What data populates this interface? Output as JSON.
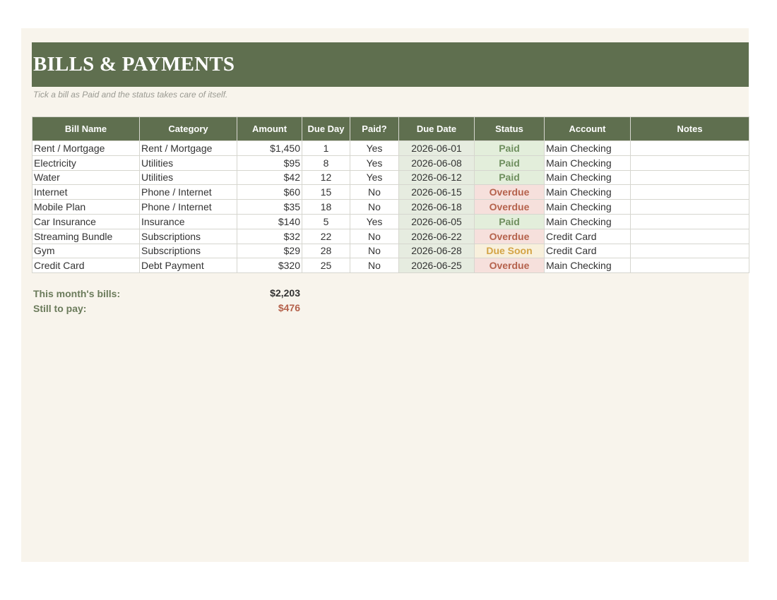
{
  "title": "BILLS & PAYMENTS",
  "subtitle": "Tick a bill as Paid and the status takes care of itself.",
  "columns": [
    "Bill Name",
    "Category",
    "Amount",
    "Due Day",
    "Paid?",
    "Due Date",
    "Status",
    "Account",
    "Notes"
  ],
  "rows": [
    {
      "name": "Rent / Mortgage",
      "category": "Rent / Mortgage",
      "amount": "$1,450",
      "due_day": "1",
      "paid": "Yes",
      "due_date": "2026-06-01",
      "status": "Paid",
      "status_kind": "paid",
      "account": "Main Checking",
      "notes": ""
    },
    {
      "name": "Electricity",
      "category": "Utilities",
      "amount": "$95",
      "due_day": "8",
      "paid": "Yes",
      "due_date": "2026-06-08",
      "status": "Paid",
      "status_kind": "paid",
      "account": "Main Checking",
      "notes": ""
    },
    {
      "name": "Water",
      "category": "Utilities",
      "amount": "$42",
      "due_day": "12",
      "paid": "Yes",
      "due_date": "2026-06-12",
      "status": "Paid",
      "status_kind": "paid",
      "account": "Main Checking",
      "notes": ""
    },
    {
      "name": "Internet",
      "category": "Phone / Internet",
      "amount": "$60",
      "due_day": "15",
      "paid": "No",
      "due_date": "2026-06-15",
      "status": "Overdue",
      "status_kind": "overdue",
      "account": "Main Checking",
      "notes": ""
    },
    {
      "name": "Mobile Plan",
      "category": "Phone / Internet",
      "amount": "$35",
      "due_day": "18",
      "paid": "No",
      "due_date": "2026-06-18",
      "status": "Overdue",
      "status_kind": "overdue",
      "account": "Main Checking",
      "notes": ""
    },
    {
      "name": "Car Insurance",
      "category": "Insurance",
      "amount": "$140",
      "due_day": "5",
      "paid": "Yes",
      "due_date": "2026-06-05",
      "status": "Paid",
      "status_kind": "paid",
      "account": "Main Checking",
      "notes": ""
    },
    {
      "name": "Streaming Bundle",
      "category": "Subscriptions",
      "amount": "$32",
      "due_day": "22",
      "paid": "No",
      "due_date": "2026-06-22",
      "status": "Overdue",
      "status_kind": "overdue",
      "account": "Credit Card",
      "notes": ""
    },
    {
      "name": "Gym",
      "category": "Subscriptions",
      "amount": "$29",
      "due_day": "28",
      "paid": "No",
      "due_date": "2026-06-28",
      "status": "Due Soon",
      "status_kind": "duesoon",
      "account": "Credit Card",
      "notes": ""
    },
    {
      "name": "Credit Card",
      "category": "Debt Payment",
      "amount": "$320",
      "due_day": "25",
      "paid": "No",
      "due_date": "2026-06-25",
      "status": "Overdue",
      "status_kind": "overdue",
      "account": "Main Checking",
      "notes": ""
    }
  ],
  "summary": {
    "month_label": "This month's bills:",
    "month_value": "$2,203",
    "remaining_label": "Still to pay:",
    "remaining_value": "$476"
  },
  "colors": {
    "header": "#5f6f4f",
    "paid": "#6f8f5f",
    "overdue": "#b5624c",
    "due_soon": "#d4a446",
    "background": "#f8f4ec"
  }
}
